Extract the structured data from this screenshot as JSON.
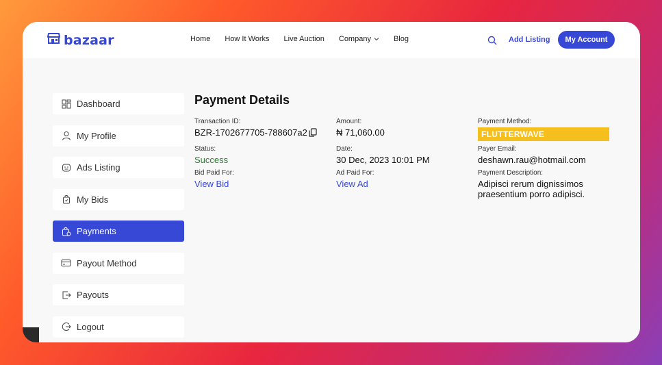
{
  "brand": {
    "name": "bazaar",
    "color": "#3747d6"
  },
  "nav": {
    "links": [
      "Home",
      "How It Works",
      "Live Auction",
      "Company",
      "Blog"
    ],
    "add_listing": "Add Listing",
    "account": "My Account"
  },
  "sidebar": {
    "items": [
      {
        "label": "Dashboard",
        "icon": "dashboard-icon"
      },
      {
        "label": "My Profile",
        "icon": "user-icon"
      },
      {
        "label": "Ads Listing",
        "icon": "ads-icon"
      },
      {
        "label": "My Bids",
        "icon": "bag-icon"
      },
      {
        "label": "Payments",
        "icon": "payments-icon",
        "active": true
      },
      {
        "label": "Payout Method",
        "icon": "card-icon"
      },
      {
        "label": "Payouts",
        "icon": "payout-icon"
      },
      {
        "label": "Logout",
        "icon": "logout-icon"
      }
    ]
  },
  "payment": {
    "title": "Payment Details",
    "transaction_id_label": "Transaction ID:",
    "transaction_id": "BZR-1702677705-788607a2",
    "amount_label": "Amount:",
    "amount": "₦ 71,060.00",
    "method_label": "Payment Method:",
    "method": "FLUTTERWAVE",
    "status_label": "Status:",
    "status": "Success",
    "date_label": "Date:",
    "date": "30 Dec, 2023 10:01 PM",
    "payer_email_label": "Payer Email:",
    "payer_email": "deshawn.rau@hotmail.com",
    "bid_label": "Bid Paid For:",
    "bid_link": "View Bid",
    "ad_label": "Ad Paid For:",
    "ad_link": "View Ad",
    "description_label": "Payment Description:",
    "description_line1": "Adipisci rerum dignissimos",
    "description_line2": "praesentium porro adipisci.",
    "colors": {
      "accent": "#3747d6",
      "success": "#2e7d32",
      "badge": "#f5c01d"
    }
  }
}
